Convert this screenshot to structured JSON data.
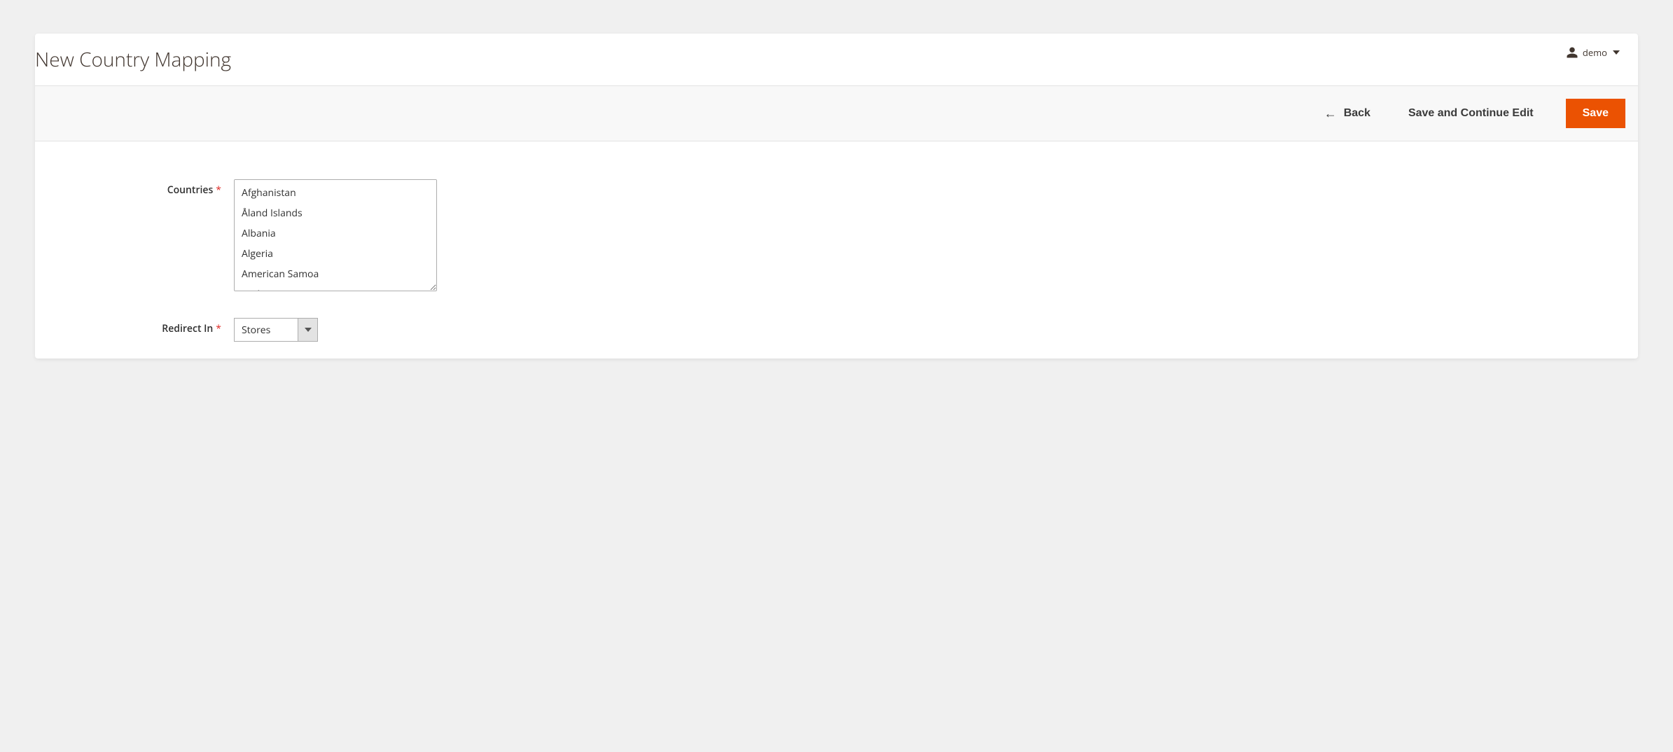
{
  "header": {
    "page_title": "New Country Mapping",
    "user_name": "demo"
  },
  "toolbar": {
    "back_label": "Back",
    "save_continue_label": "Save and Continue Edit",
    "save_label": "Save"
  },
  "form": {
    "countries_label": "Countries",
    "countries_options": [
      "Afghanistan",
      "Åland Islands",
      "Albania",
      "Algeria",
      "American Samoa",
      "Andorra"
    ],
    "redirect_in_label": "Redirect In",
    "redirect_in_value": "Stores"
  }
}
